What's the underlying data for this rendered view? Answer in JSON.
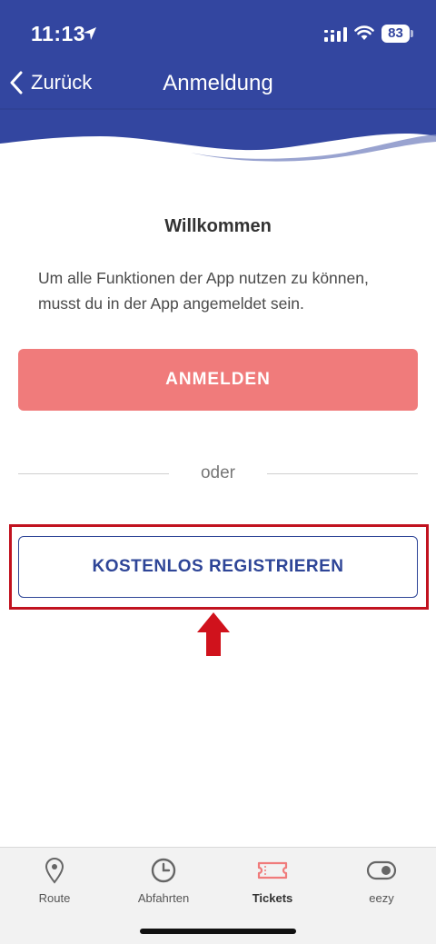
{
  "status_bar": {
    "time": "11:13",
    "battery": "83"
  },
  "nav": {
    "back_label": "Zurück",
    "title": "Anmeldung"
  },
  "content": {
    "welcome": "Willkommen",
    "description": "Um alle Funktionen der App nutzen zu können, musst du in der App angemeldet sein.",
    "login_button": "ANMELDEN",
    "divider_text": "oder",
    "register_button": "KOSTENLOS REGISTRIEREN"
  },
  "tabbar": {
    "tabs": [
      {
        "label": "Route",
        "icon": "location-pin-icon"
      },
      {
        "label": "Abfahrten",
        "icon": "clock-icon"
      },
      {
        "label": "Tickets",
        "icon": "ticket-icon",
        "active": true
      },
      {
        "label": "eezy",
        "icon": "toggle-icon"
      }
    ]
  },
  "colors": {
    "header": "#3346a0",
    "login_button": "#f07b7b",
    "register_text": "#2e4597",
    "highlight": "#c1121f",
    "active_tab": "#f07b7b"
  }
}
